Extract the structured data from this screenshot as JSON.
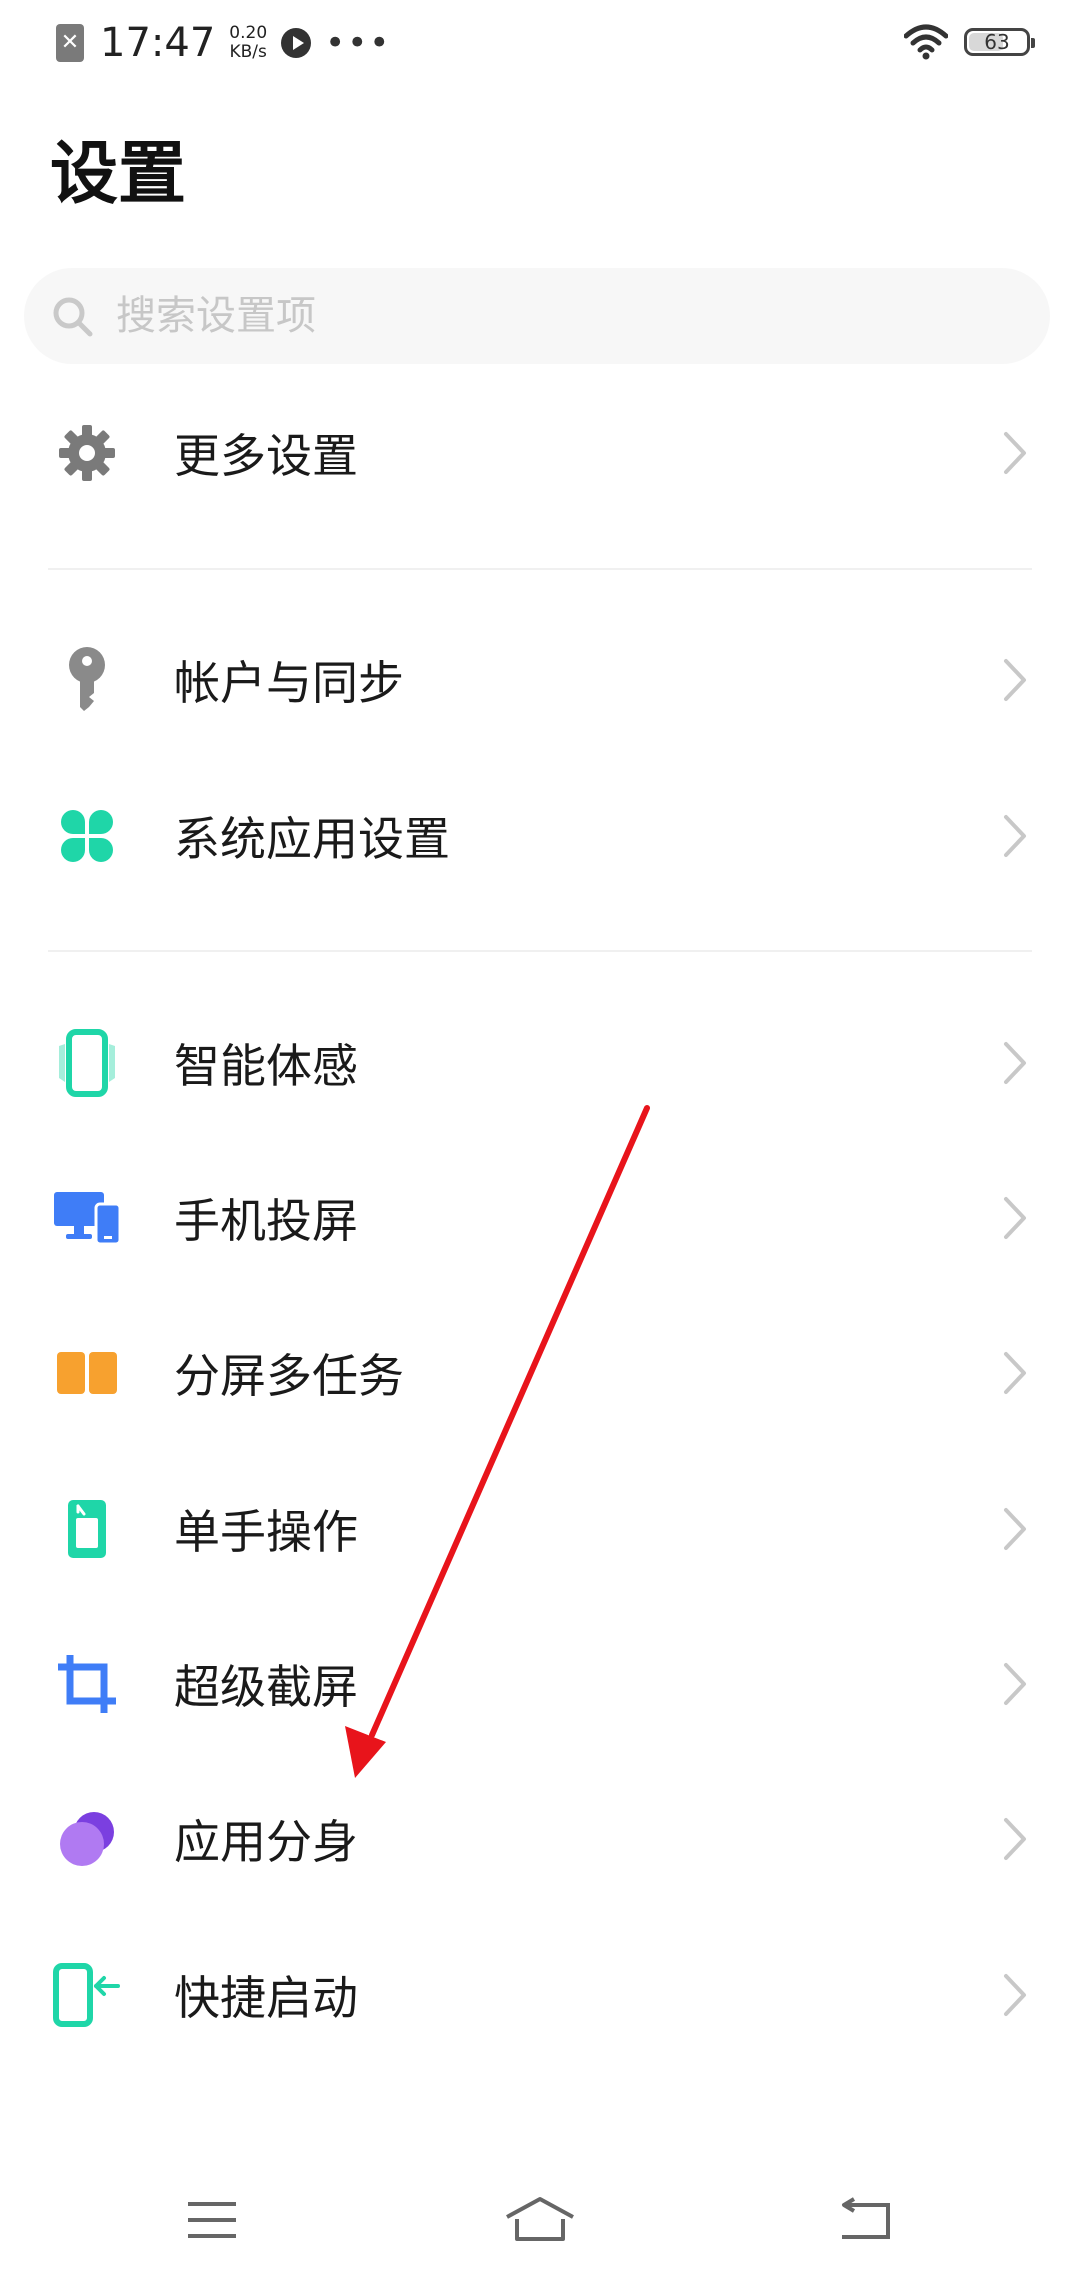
{
  "status_bar": {
    "time": "17:47",
    "speed_value": "0.20",
    "speed_unit": "KB/s",
    "more_dots": "•••",
    "battery_level": "63",
    "battery_fraction": 0.63
  },
  "page_title": "设置",
  "search": {
    "placeholder": "搜索设置项"
  },
  "items": [
    {
      "label": "更多设置",
      "icon": "gear-icon",
      "color": "#7a7a7a"
    },
    {
      "label": "帐户与同步",
      "icon": "key-icon",
      "color": "#8a8a8a"
    },
    {
      "label": "系统应用设置",
      "icon": "clover-icon",
      "color": "#1fd6a8"
    },
    {
      "label": "智能体感",
      "icon": "phone-motion-icon",
      "color": "#1fd6a8"
    },
    {
      "label": "手机投屏",
      "icon": "screencast-icon",
      "color": "#3f7df7"
    },
    {
      "label": "分屏多任务",
      "icon": "split-screen-icon",
      "color": "#f7a12f"
    },
    {
      "label": "单手操作",
      "icon": "one-hand-icon",
      "color": "#1fd6a8"
    },
    {
      "label": "超级截屏",
      "icon": "crop-icon",
      "color": "#3f7df7"
    },
    {
      "label": "应用分身",
      "icon": "app-clone-icon",
      "color": "#a86cf0"
    },
    {
      "label": "快捷启动",
      "icon": "quick-launch-icon",
      "color": "#1fd6a8"
    }
  ],
  "annotation_color": "#e8141b"
}
